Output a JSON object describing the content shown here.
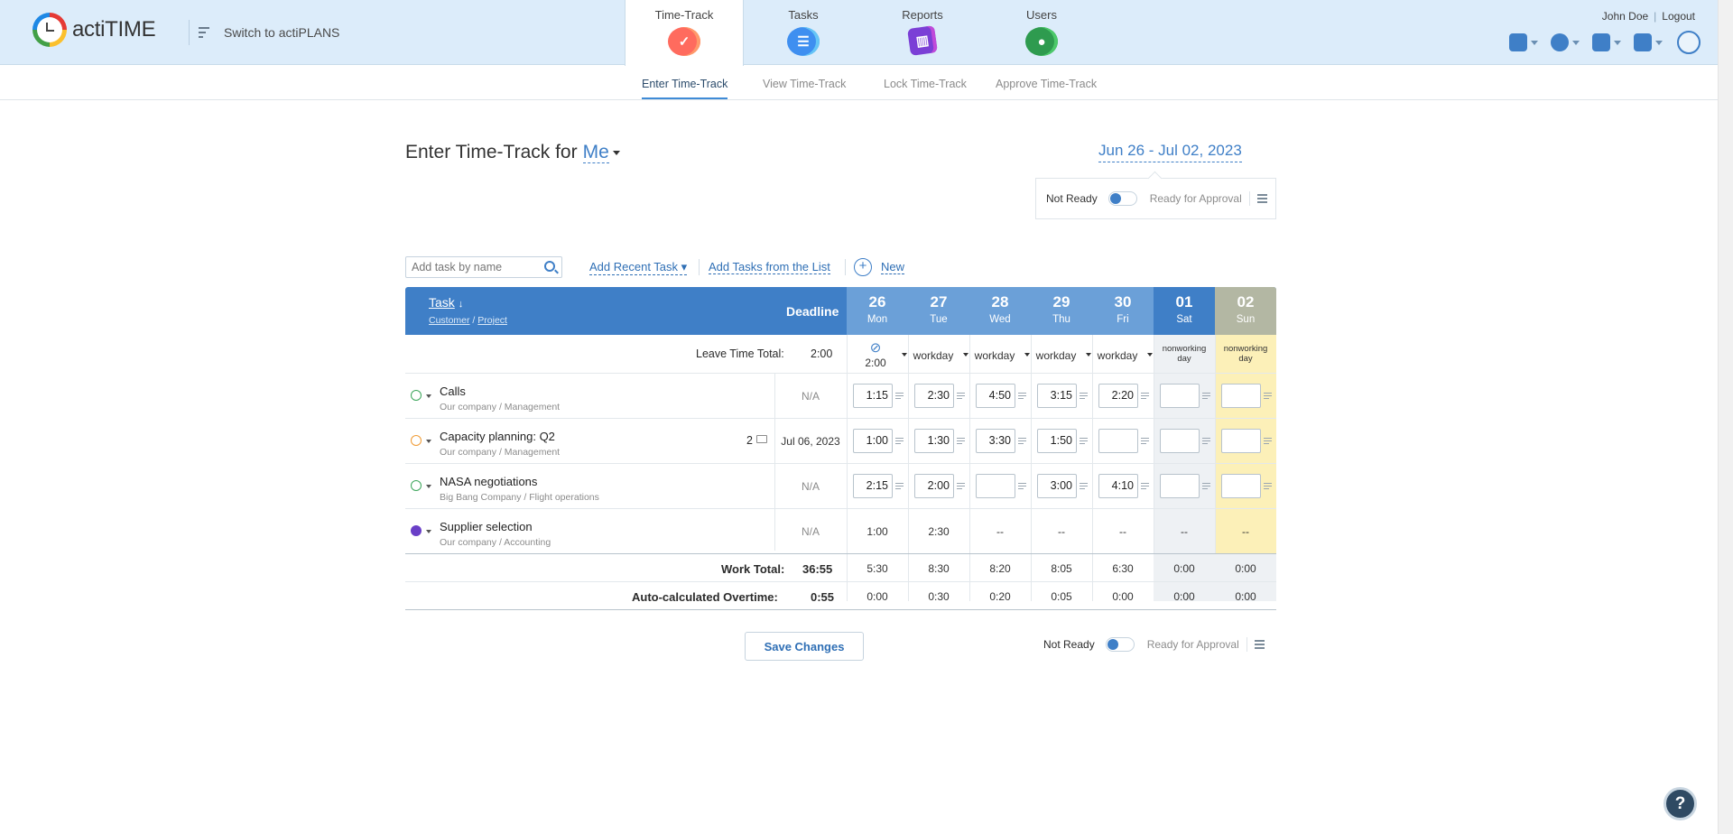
{
  "app": {
    "name": "actiTIME",
    "switch_label": "Switch to actiPLANS"
  },
  "modules": [
    {
      "label": "Time-Track",
      "icon": "time-track-icon",
      "active": true
    },
    {
      "label": "Tasks",
      "icon": "tasks-icon"
    },
    {
      "label": "Reports",
      "icon": "reports-icon"
    },
    {
      "label": "Users",
      "icon": "users-icon"
    }
  ],
  "user": {
    "name": "John Doe",
    "logout": "Logout"
  },
  "subtabs": [
    "Enter Time-Track",
    "View Time-Track",
    "Lock Time-Track",
    "Approve Time-Track"
  ],
  "page": {
    "title": "Enter Time-Track for",
    "who": "Me",
    "date_range": "Jun 26 - Jul 02, 2023"
  },
  "approval": {
    "not_ready": "Not Ready",
    "ready": "Ready for Approval"
  },
  "toolbar": {
    "search_placeholder": "Add task by name",
    "add_recent": "Add Recent Task",
    "add_list": "Add Tasks from the List",
    "new": "New"
  },
  "table": {
    "task_header": "Task",
    "customer_label": "Customer",
    "project_label": "Project",
    "deadline_header": "Deadline",
    "days": [
      {
        "num": "26",
        "dow": "Mon"
      },
      {
        "num": "27",
        "dow": "Tue"
      },
      {
        "num": "28",
        "dow": "Wed"
      },
      {
        "num": "29",
        "dow": "Thu"
      },
      {
        "num": "30",
        "dow": "Fri"
      },
      {
        "num": "01",
        "dow": "Sat"
      },
      {
        "num": "02",
        "dow": "Sun"
      }
    ],
    "leave": {
      "label": "Leave Time Total:",
      "total": "2:00",
      "mon_value": "2:00",
      "day_types": [
        "workday",
        "workday",
        "workday",
        "workday",
        "nonworking day",
        "nonworking day"
      ]
    },
    "tasks": [
      {
        "name": "Calls",
        "customer": "Our company",
        "project": "Management",
        "comments": "",
        "deadline": "N/A",
        "times": [
          "1:15",
          "2:30",
          "4:50",
          "3:15",
          "2:20",
          "",
          ""
        ]
      },
      {
        "name": "Capacity planning: Q2",
        "customer": "Our company",
        "project": "Management",
        "comments": "2",
        "deadline": "Jul 06, 2023",
        "times": [
          "1:00",
          "1:30",
          "3:30",
          "1:50",
          "",
          "",
          ""
        ]
      },
      {
        "name": "NASA negotiations",
        "customer": "Big Bang Company",
        "project": "Flight operations",
        "comments": "",
        "deadline": "N/A",
        "times": [
          "2:15",
          "2:00",
          "",
          "3:00",
          "4:10",
          "",
          ""
        ]
      },
      {
        "name": "Supplier selection",
        "customer": "Our company",
        "project": "Accounting",
        "comments": "",
        "deadline": "N/A",
        "times": [
          "1:00",
          "2:30",
          "--",
          "--",
          "--",
          "--",
          "--"
        ]
      }
    ],
    "work_total": {
      "label": "Work Total:",
      "total": "36:55",
      "days": [
        "5:30",
        "8:30",
        "8:20",
        "8:05",
        "6:30",
        "0:00",
        "0:00"
      ]
    },
    "overtime": {
      "label": "Auto-calculated Overtime:",
      "total": "0:55",
      "days": [
        "0:00",
        "0:30",
        "0:20",
        "0:05",
        "0:00",
        "0:00",
        "0:00"
      ]
    }
  },
  "save_label": "Save Changes",
  "help": "?"
}
